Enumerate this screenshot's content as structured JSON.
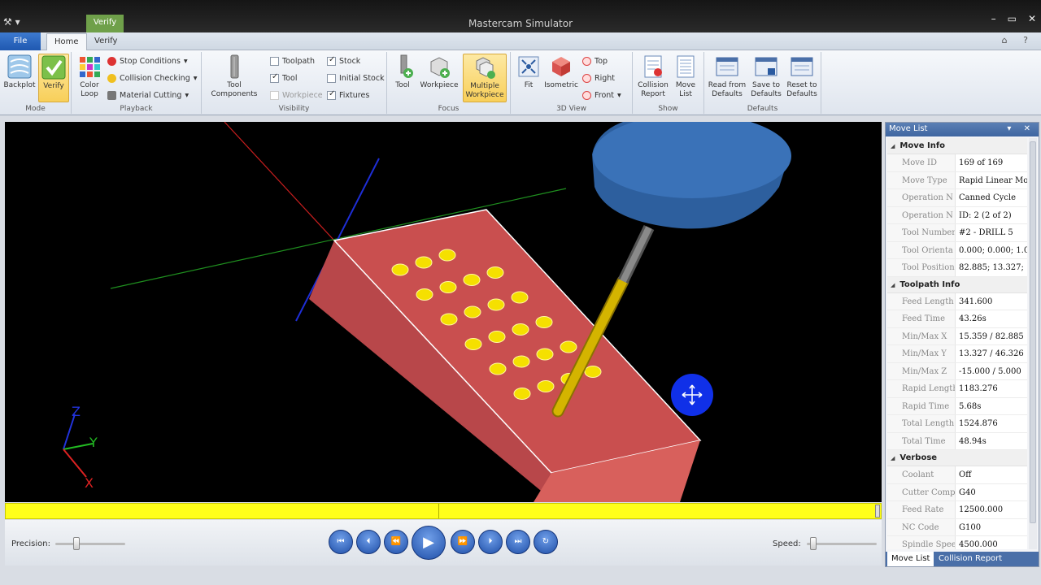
{
  "window": {
    "title": "Mastercam Simulator",
    "context_tab": "Verify"
  },
  "tabs": {
    "file": "File",
    "home": "Home",
    "verify": "Verify"
  },
  "ribbon": {
    "mode": {
      "label": "Mode",
      "backplot": "Backplot",
      "verify": "Verify"
    },
    "playback": {
      "label": "Playback",
      "color_loop": "Color\nLoop",
      "stop_conditions": "Stop Conditions",
      "collision_checking": "Collision Checking",
      "material_cutting": "Material Cutting"
    },
    "visibility": {
      "label": "Visibility",
      "tool_components": "Tool\nComponents",
      "toolpath": "Toolpath",
      "tool": "Tool",
      "workpiece": "Workpiece",
      "stock": "Stock",
      "initial_stock": "Initial Stock",
      "fixtures": "Fixtures"
    },
    "focus": {
      "label": "Focus",
      "tool": "Tool",
      "workpiece": "Workpiece",
      "multiple_workpiece": "Multiple\nWorkpiece"
    },
    "view3d": {
      "label": "3D View",
      "fit": "Fit",
      "isometric": "Isometric",
      "top": "Top",
      "right": "Right",
      "front": "Front"
    },
    "show": {
      "label": "Show",
      "collision_report": "Collision\nReport",
      "move_list": "Move\nList"
    },
    "defaults": {
      "label": "Defaults",
      "read_from": "Read from\nDefaults",
      "save_to": "Save to\nDefaults",
      "reset_to": "Reset to\nDefaults"
    }
  },
  "viewport": {
    "axis_labels": {
      "x": "X",
      "y": "Y",
      "z": "Z"
    }
  },
  "controls": {
    "precision_label": "Precision:",
    "speed_label": "Speed:"
  },
  "panel": {
    "title": "Move List",
    "sections": {
      "move_info": {
        "title": "Move Info",
        "rows": [
          {
            "k": "Move ID",
            "v": "169 of 169"
          },
          {
            "k": "Move Type",
            "v": "Rapid Linear Mo"
          },
          {
            "k": "Operation N",
            "v": "Canned Cycle"
          },
          {
            "k": "Operation N",
            "v": "ID: 2 (2 of 2)"
          },
          {
            "k": "Tool Number",
            "v": "#2 - DRILL 5"
          },
          {
            "k": "Tool Orienta",
            "v": "0.000; 0.000; 1.0"
          },
          {
            "k": "Tool Position",
            "v": "82.885; 13.327;"
          }
        ]
      },
      "toolpath_info": {
        "title": "Toolpath Info",
        "rows": [
          {
            "k": "Feed Length",
            "v": "341.600"
          },
          {
            "k": "Feed Time",
            "v": "43.26s"
          },
          {
            "k": "Min/Max X",
            "v": "15.359 / 82.885"
          },
          {
            "k": "Min/Max Y",
            "v": "13.327 / 46.326"
          },
          {
            "k": "Min/Max Z",
            "v": "-15.000 / 5.000"
          },
          {
            "k": "Rapid Length",
            "v": "1183.276"
          },
          {
            "k": "Rapid Time",
            "v": "5.68s"
          },
          {
            "k": "Total Length",
            "v": "1524.876"
          },
          {
            "k": "Total Time",
            "v": "48.94s"
          }
        ]
      },
      "verbose": {
        "title": "Verbose",
        "rows": [
          {
            "k": "Coolant",
            "v": "Off"
          },
          {
            "k": "Cutter Comp",
            "v": "G40"
          },
          {
            "k": "Feed Rate",
            "v": "12500.000"
          },
          {
            "k": "NC Code",
            "v": "G100"
          },
          {
            "k": "Spindle Spee",
            "v": "4500.000"
          }
        ]
      }
    },
    "bottom_tabs": {
      "move_list": "Move List",
      "collision_report": "Collision Report"
    }
  },
  "colors": {
    "stock": "#d8605c",
    "hole": "#f5e000",
    "holder": "#2f62a8",
    "drill": "#d4b400",
    "progress": "#ffff1a"
  }
}
